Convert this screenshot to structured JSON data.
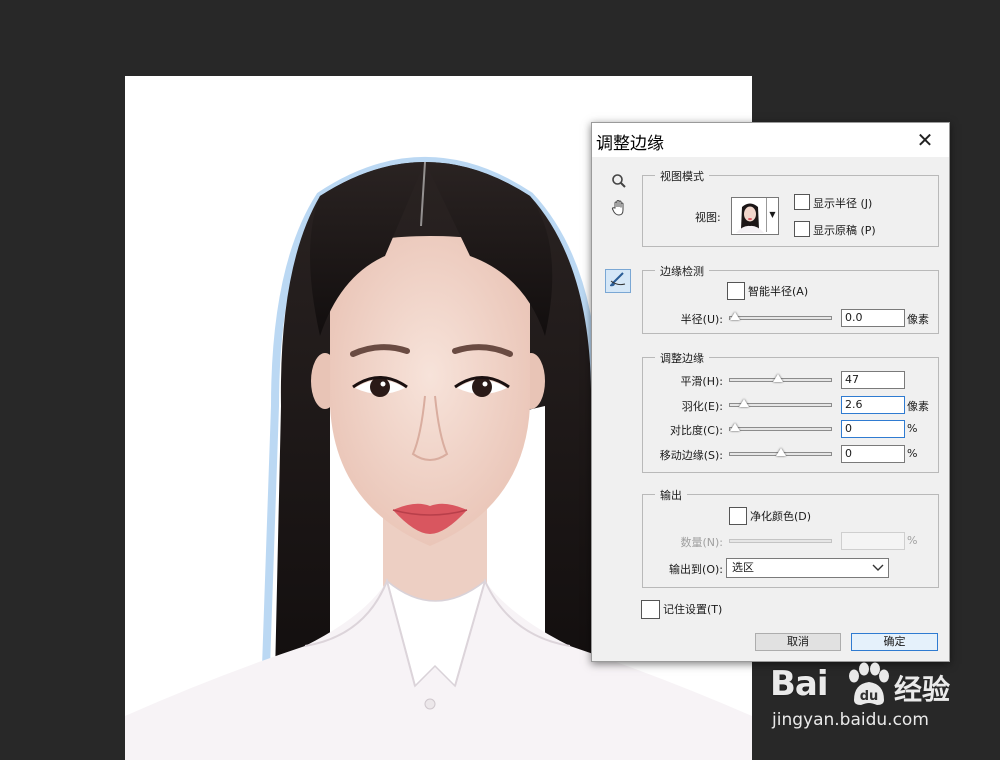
{
  "dialog": {
    "title": "调整边缘",
    "tools": [
      "zoom-icon",
      "hand-icon",
      "refine-radius-brush-icon"
    ],
    "view_mode": {
      "legend": "视图模式",
      "view_label": "视图:",
      "show_radius": "显示半径 (J)",
      "show_original": "显示原稿 (P)"
    },
    "edge_detection": {
      "legend": "边缘检测",
      "smart_radius": "智能半径(A)",
      "radius_label": "半径(U):",
      "radius_value": "0.0",
      "radius_unit": "像素",
      "radius_level": 0
    },
    "adjust_edge": {
      "legend": "调整边缘",
      "smooth_label": "平滑(H):",
      "smooth_value": "47",
      "smooth_level": 0.47,
      "feather_label": "羽化(E):",
      "feather_value": "2.6",
      "feather_unit": "像素",
      "feather_level": 0.1,
      "contrast_label": "对比度(C):",
      "contrast_value": "0",
      "contrast_unit": "%",
      "contrast_level": 0,
      "shift_label": "移动边缘(S):",
      "shift_value": "0",
      "shift_unit": "%",
      "shift_level": 0.5
    },
    "output": {
      "legend": "输出",
      "decontaminate": "净化颜色(D)",
      "amount_label": "数量(N):",
      "amount_unit": "%",
      "output_to_label": "输出到(O):",
      "output_to_value": "选区"
    },
    "remember": "记住设置(T)",
    "cancel": "取消",
    "ok": "确定"
  },
  "watermark": {
    "logo": "Bai",
    "logo_cn": "经验",
    "url": "jingyan.baidu.com"
  },
  "colors": {
    "workspace": "#282828",
    "dialog_bg": "#f0f0f0",
    "accent": "#2f7bd1",
    "hair": "#1b1616",
    "skin": "#f3dad0",
    "lips": "#d9565f"
  }
}
